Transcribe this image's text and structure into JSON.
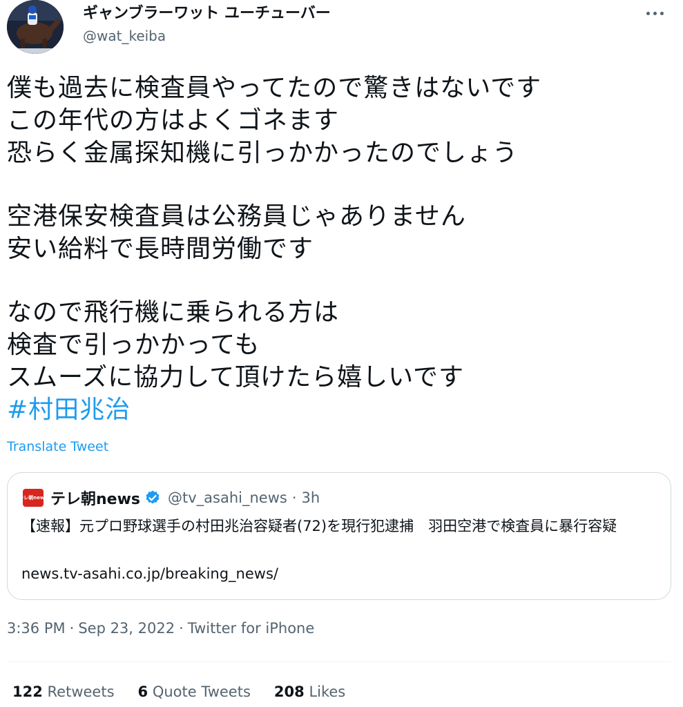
{
  "author": {
    "display_name": "ギャンブラーワット ユーチューバー",
    "handle": "@wat_keiba",
    "avatar_icon": "jockey-on-horse-photo"
  },
  "more_icon": "more-dots-icon",
  "tweet": {
    "lines": [
      "僕も過去に検査員やってたので驚きはないです",
      "この年代の方はよくゴネます",
      "恐らく金属探知機に引っかかったのでしょう",
      "空港保安検査員は公務員じゃありません",
      "安い給料で長時間労働です",
      "なので飛行機に乗られる方は",
      "検査で引っかかっても",
      "スムーズに協力して頂けたら嬉しいです"
    ],
    "hashtag": "#村田兆治",
    "translate_label": "Translate Tweet"
  },
  "quote": {
    "avatar_text": "テレ朝news",
    "name": "テレ朝news",
    "verified_icon": "verified-badge-icon",
    "handle": "@tv_asahi_news",
    "separator": "·",
    "time": "3h",
    "body": "【速報】元プロ野球選手の村田兆治容疑者(72)を現行犯逮捕　羽田空港で検査員に暴行容疑",
    "link": "news.tv-asahi.co.jp/breaking_news/"
  },
  "meta": {
    "time": "3:36 PM",
    "sep1": "·",
    "date": "Sep 23, 2022",
    "sep2": "·",
    "source": "Twitter for iPhone"
  },
  "stats": {
    "retweets_count": "122",
    "retweets_label": "Retweets",
    "quotes_count": "6",
    "quotes_label": "Quote Tweets",
    "likes_count": "208",
    "likes_label": "Likes"
  },
  "colors": {
    "link": "#1d9bf0",
    "secondary_text": "#536471",
    "border": "#cfd9de",
    "verified": "#1d9bf0",
    "tv_asahi_red": "#d7261e"
  }
}
